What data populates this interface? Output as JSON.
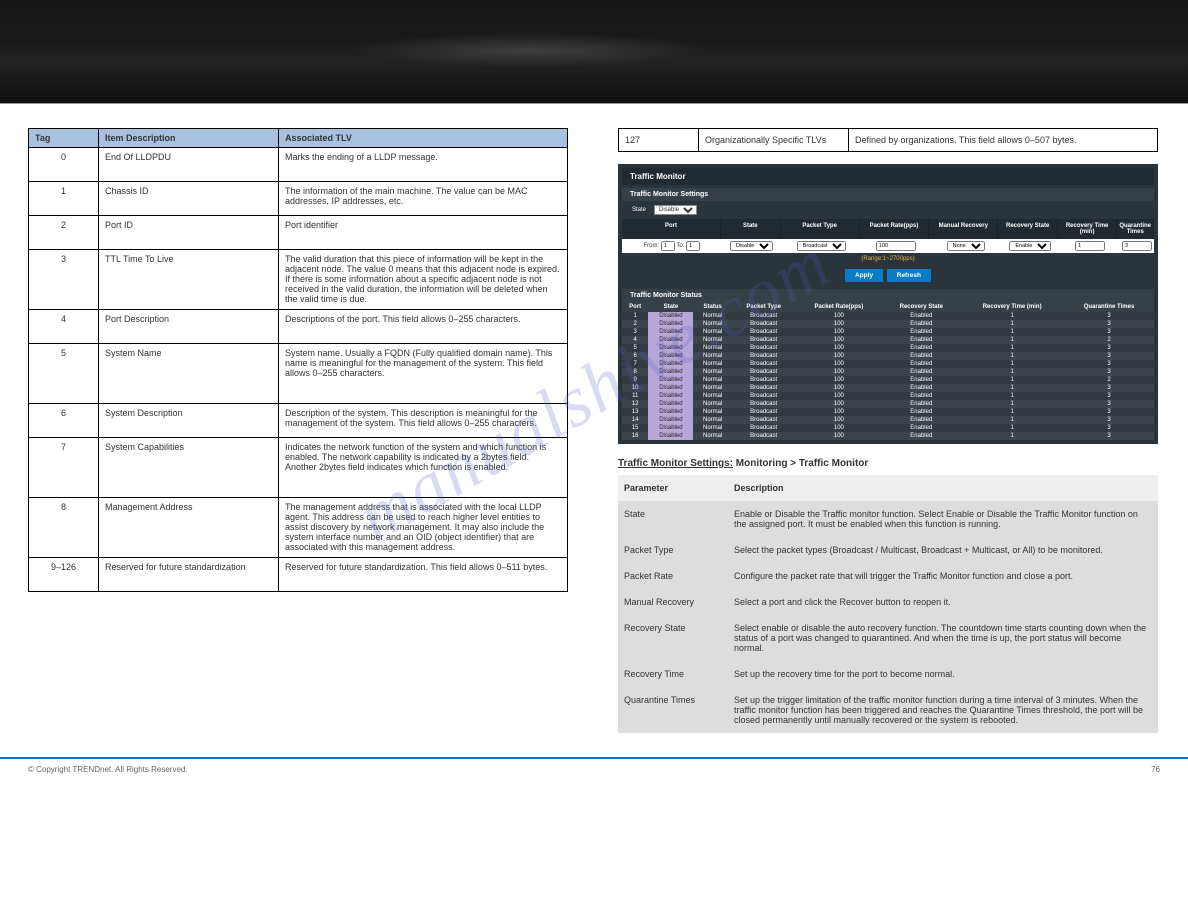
{
  "watermark": "manualshive.com",
  "left_table": {
    "headers": [
      "Tag",
      "Item Description",
      "Associated TLV"
    ],
    "rows": [
      {
        "tag": "0",
        "item": "End Of LLDPDU",
        "tlv": "Marks the ending of a LLDP message.",
        "multi": false
      },
      {
        "tag": "1",
        "item": "Chassis ID",
        "tlv": "The information of the main machine. The value can be MAC addresses, IP addresses, etc.",
        "multi": false
      },
      {
        "tag": "2",
        "item": "Port ID",
        "tlv": "Port identifier",
        "multi": false
      },
      {
        "tag": "3",
        "item": "TTL Time To Live",
        "tlv": "The valid duration that this piece of information will be kept in the adjacent node. The value 0 means that this adjacent node is expired. If there is some information about a specific adjacent node is not received in the valid duration, the information will be deleted when the valid time is due.",
        "multi": true
      },
      {
        "tag": "4",
        "item": "Port Description",
        "tlv": "Descriptions of the port. This field allows 0–255 characters.",
        "multi": false
      },
      {
        "tag": "5",
        "item": "System Name",
        "tlv": "System name. Usually a FQDN (Fully qualified domain name). This name is meaningful for the management of the system. This field allows 0–255 characters.",
        "multi": true
      },
      {
        "tag": "6",
        "item": "System Description",
        "tlv": "Description of the system. This description is meaningful for the management of the system. This field allows 0–255 characters.",
        "multi": false
      },
      {
        "tag": "7",
        "item": "System Capabilities",
        "tlv": "Indicates the network function of the system and which function is enabled. The network capability is indicated by a 2bytes field. Another 2bytes field indicates which function is enabled.",
        "multi": true
      },
      {
        "tag": "8",
        "item": "Management Address",
        "tlv": "The management address that is associated with the local LLDP agent. This address can be used to reach higher level entities to assist discovery by network management. It may also include the system interface number and an OID (object identifier) that are associated with this management address.",
        "multi": true
      },
      {
        "tag": "9–126",
        "item": "Reserved for future standardization",
        "tlv": "Reserved for future standardization. This field allows 0–511 bytes.",
        "multi": false
      }
    ]
  },
  "right_top_table": {
    "rows": [
      {
        "c1": "127",
        "c2": "Organizationally Specific TLVs",
        "c3": "Defined by organizations. This field allows 0–507 bytes."
      }
    ]
  },
  "screenshot": {
    "title": "Traffic Monitor",
    "settings_title": "Traffic Monitor Settings",
    "state_label": "State",
    "state_value": "Disable",
    "headers": [
      "Port",
      "State",
      "Packet Type",
      "Packet Rate(pps)",
      "Manual Recovery",
      "Recovery State",
      "Recovery Time (min)",
      "Quarantine Times"
    ],
    "filter": {
      "from_label": "From:",
      "from_val": "1",
      "to_label": "To:",
      "to_val": "1",
      "state": "Disable",
      "ptype": "Broadcast",
      "rate": "100",
      "manual": "None",
      "rstate": "Enable",
      "rtime": "1",
      "qtimes": "3"
    },
    "range": "(Range:1~2700pps)",
    "apply": "Apply",
    "refresh": "Refresh",
    "status_title": "Traffic Monitor Status",
    "status_headers": [
      "Port",
      "State",
      "Status",
      "Packet Type",
      "Packet Rate(pps)",
      "Recovery State",
      "Recovery Time (min)",
      "Quarantine Times"
    ],
    "status_rows": [
      {
        "port": "1",
        "state": "Disabled",
        "status": "Normal",
        "ptype": "Broadcast",
        "rate": "100",
        "rstate": "Enabled",
        "rtime": "1",
        "qtimes": "3"
      },
      {
        "port": "2",
        "state": "Disabled",
        "status": "Normal",
        "ptype": "Broadcast",
        "rate": "100",
        "rstate": "Enabled",
        "rtime": "1",
        "qtimes": "3"
      },
      {
        "port": "3",
        "state": "Disabled",
        "status": "Normal",
        "ptype": "Broadcast",
        "rate": "100",
        "rstate": "Enabled",
        "rtime": "1",
        "qtimes": "3"
      },
      {
        "port": "4",
        "state": "Disabled",
        "status": "Normal",
        "ptype": "Broadcast",
        "rate": "100",
        "rstate": "Enabled",
        "rtime": "1",
        "qtimes": "2"
      },
      {
        "port": "5",
        "state": "Disabled",
        "status": "Normal",
        "ptype": "Broadcast",
        "rate": "100",
        "rstate": "Enabled",
        "rtime": "1",
        "qtimes": "3"
      },
      {
        "port": "6",
        "state": "Disabled",
        "status": "Normal",
        "ptype": "Broadcast",
        "rate": "100",
        "rstate": "Enabled",
        "rtime": "1",
        "qtimes": "3"
      },
      {
        "port": "7",
        "state": "Disabled",
        "status": "Normal",
        "ptype": "Broadcast",
        "rate": "100",
        "rstate": "Enabled",
        "rtime": "1",
        "qtimes": "3"
      },
      {
        "port": "8",
        "state": "Disabled",
        "status": "Normal",
        "ptype": "Broadcast",
        "rate": "100",
        "rstate": "Enabled",
        "rtime": "1",
        "qtimes": "3"
      },
      {
        "port": "9",
        "state": "Disabled",
        "status": "Normal",
        "ptype": "Broadcast",
        "rate": "100",
        "rstate": "Enabled",
        "rtime": "1",
        "qtimes": "2"
      },
      {
        "port": "10",
        "state": "Disabled",
        "status": "Normal",
        "ptype": "Broadcast",
        "rate": "100",
        "rstate": "Enabled",
        "rtime": "1",
        "qtimes": "3"
      },
      {
        "port": "11",
        "state": "Disabled",
        "status": "Normal",
        "ptype": "Broadcast",
        "rate": "100",
        "rstate": "Enabled",
        "rtime": "1",
        "qtimes": "3"
      },
      {
        "port": "12",
        "state": "Disabled",
        "status": "Normal",
        "ptype": "Broadcast",
        "rate": "100",
        "rstate": "Enabled",
        "rtime": "1",
        "qtimes": "3"
      },
      {
        "port": "13",
        "state": "Disabled",
        "status": "Normal",
        "ptype": "Broadcast",
        "rate": "100",
        "rstate": "Enabled",
        "rtime": "1",
        "qtimes": "3"
      },
      {
        "port": "14",
        "state": "Disabled",
        "status": "Normal",
        "ptype": "Broadcast",
        "rate": "100",
        "rstate": "Enabled",
        "rtime": "1",
        "qtimes": "3"
      },
      {
        "port": "15",
        "state": "Disabled",
        "status": "Normal",
        "ptype": "Broadcast",
        "rate": "100",
        "rstate": "Enabled",
        "rtime": "1",
        "qtimes": "3"
      },
      {
        "port": "16",
        "state": "Disabled",
        "status": "Normal",
        "ptype": "Broadcast",
        "rate": "100",
        "rstate": "Enabled",
        "rtime": "1",
        "qtimes": "3"
      }
    ]
  },
  "heading_prefix": "Traffic Monitor Settings:",
  "heading_rest": " Monitoring > Traffic Monitor",
  "gray_table": {
    "headers": [
      "Parameter",
      "Description"
    ],
    "rows": [
      {
        "p": "State",
        "d": "Enable or Disable the Traffic monitor function. Select Enable or Disable the Traffic Monitor function on the assigned port. It must be enabled when this function is running."
      },
      {
        "p": "Packet Type",
        "d": "Select the packet types (Broadcast / Multicast, Broadcast + Multicast, or All) to be monitored."
      },
      {
        "p": "Packet Rate",
        "d": "Configure the packet rate that will trigger the Traffic Monitor function and close a port."
      },
      {
        "p": "Manual Recovery",
        "d": "Select a port and click the Recover button to reopen it."
      },
      {
        "p": "Recovery State",
        "d": "Select enable or disable the auto recovery function. The countdown time starts counting down when the status of a port was changed to quarantined. And when the time is up, the port status will become normal."
      },
      {
        "p": "Recovery Time",
        "d": "Set up the recovery time for the port to become normal."
      },
      {
        "p": "Quarantine Times",
        "d": "Set up the trigger limitation of the traffic monitor function during a time interval of 3 minutes. When the traffic monitor function has been triggered and reaches the Quarantine Times threshold, the port will be closed permanently until manually recovered or the system is rebooted."
      }
    ]
  },
  "footer": {
    "copy": "© Copyright TRENDnet. All Rights Reserved.",
    "page": "76"
  }
}
